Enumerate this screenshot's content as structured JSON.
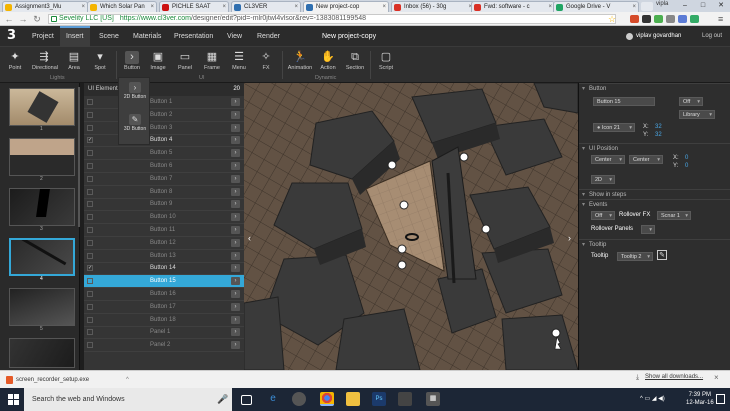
{
  "browser": {
    "tabs": [
      {
        "label": "Assignment3_Mu",
        "fav_color": "#f4b400"
      },
      {
        "label": "Which Solar Pan",
        "fav_color": "#f4b400"
      },
      {
        "label": "PICHLE SAAT",
        "fav_color": "#cc1111"
      },
      {
        "label": "CL3VER",
        "fav_color": "#2f6fb0"
      },
      {
        "label": "New project-cop",
        "fav_color": "#2f6fb0"
      },
      {
        "label": "Inbox (56) - 30g",
        "fav_color": "#d93025"
      },
      {
        "label": "Fwd: software - c",
        "fav_color": "#d93025"
      },
      {
        "label": "Google Drive - V",
        "fav_color": "#1fa463"
      }
    ],
    "user_chip": "vipla",
    "ev_label": "Sevelity LLC [US]",
    "url_host": "https://www.cl3ver.com",
    "url_path": "/designer/edit?pid=-mlr0jtwl4vlsor&rev=-1383081199548",
    "window_controls": [
      "–",
      "□",
      "✕"
    ]
  },
  "app": {
    "logo": "3",
    "menus": [
      "Project",
      "Insert",
      "Scene",
      "Materials",
      "Presentation",
      "View",
      "Render"
    ],
    "active_menu": "Insert",
    "project_title": "New project-copy",
    "user_name": "viplav govardhan",
    "logout": "Log out"
  },
  "toolbar": {
    "tools": [
      {
        "label": "Point",
        "icon": "point-light-icon"
      },
      {
        "label": "Directional",
        "icon": "directional-light-icon"
      },
      {
        "label": "Area",
        "icon": "area-light-icon"
      },
      {
        "label": "Spot",
        "icon": "spot-light-icon"
      },
      {
        "label": "Button",
        "icon": "button-icon"
      },
      {
        "label": "Image",
        "icon": "image-icon"
      },
      {
        "label": "Panel",
        "icon": "panel-icon"
      },
      {
        "label": "Frame",
        "icon": "frame-icon"
      },
      {
        "label": "Menu",
        "icon": "menu-icon"
      },
      {
        "label": "FX",
        "icon": "fx-icon"
      },
      {
        "label": "Animation",
        "icon": "animation-icon"
      },
      {
        "label": "Action",
        "icon": "action-icon"
      },
      {
        "label": "Section",
        "icon": "section-icon"
      },
      {
        "label": "Script",
        "icon": "script-icon"
      }
    ],
    "groups": [
      "Lights",
      "UI",
      "Dynamic"
    ]
  },
  "flyout": [
    {
      "label": "2D Button",
      "icon": "2d-button-icon"
    },
    {
      "label": "3D Button",
      "icon": "3d-button-icon"
    }
  ],
  "thumbnails": [
    "1",
    "2",
    "3",
    "4",
    "5",
    "6"
  ],
  "selected_thumbnail": "4",
  "ui_elements": {
    "header": "UI Elements",
    "count": "20",
    "rows": [
      {
        "label": "Button 1",
        "checked": false
      },
      {
        "label": "Button 2",
        "checked": false
      },
      {
        "label": "Button 3",
        "checked": false
      },
      {
        "label": "Button 4",
        "checked": true
      },
      {
        "label": "Button 5",
        "checked": false
      },
      {
        "label": "Button 6",
        "checked": false
      },
      {
        "label": "Button 7",
        "checked": false
      },
      {
        "label": "Button 8",
        "checked": false
      },
      {
        "label": "Button 9",
        "checked": false
      },
      {
        "label": "Button 10",
        "checked": false
      },
      {
        "label": "Button 11",
        "checked": false
      },
      {
        "label": "Button 12",
        "checked": false
      },
      {
        "label": "Button 13",
        "checked": false
      },
      {
        "label": "Button 14",
        "checked": true
      },
      {
        "label": "Button 15",
        "checked": false
      },
      {
        "label": "Button 16",
        "checked": false
      },
      {
        "label": "Button 17",
        "checked": false
      },
      {
        "label": "Button 18",
        "checked": false
      },
      {
        "label": "Panel 1",
        "checked": false
      },
      {
        "label": "Panel 2",
        "checked": false
      }
    ],
    "selected": "Button 15"
  },
  "props": {
    "button_section": "Button",
    "name_value": "Button 15",
    "visibility": "Off",
    "library": "Library",
    "icon_value": "Icon 21",
    "x_label": "X:",
    "x_value": "32",
    "y_label": "Y:",
    "y_value": "32",
    "ui_position_section": "UI Position",
    "h_align": "Center",
    "v_align": "Center",
    "pos_x_label": "X:",
    "pos_x_value": "0",
    "pos_y_label": "Y:",
    "pos_y_value": "0",
    "mode": "2D",
    "show_in_steps": "Show in steps",
    "events_section": "Events",
    "events_toggle": "Off",
    "rollover_fx_label": "Rollover FX",
    "rollover_fx_value": "Scnar 1",
    "rollover_panels_label": "Rollover Panels",
    "tooltip_section": "Tooltip",
    "tooltip_label": "Tooltip",
    "tooltip_value": "Tooltip 2"
  },
  "download": {
    "file": "screen_recorder_setup.exe",
    "show_all": "Show all downloads..."
  },
  "taskbar": {
    "search": "Search the web and Windows",
    "time": "7:39 PM",
    "date": "12-Mar-16"
  }
}
